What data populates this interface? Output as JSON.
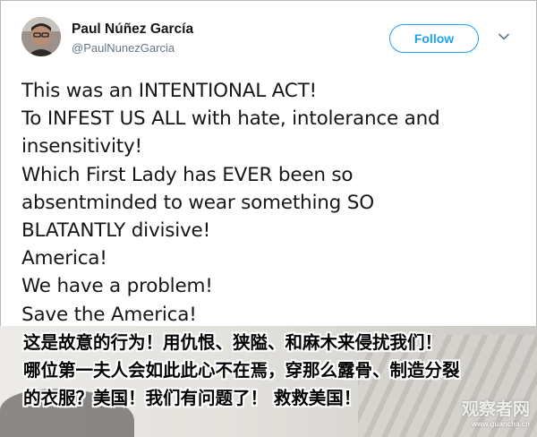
{
  "tweet": {
    "author": {
      "name": "Paul Núñez García",
      "handle": "@PaulNunezGarcia"
    },
    "follow_label": "Follow",
    "text_lines": [
      "This was an INTENTIONAL ACT!",
      "To INFEST US ALL with hate,  intolerance and",
      "insensitivity!",
      "Which First Lady has EVER been so",
      "absentminded to wear something SO",
      "BLATANTLY divisive!",
      "America!",
      "We have a problem!",
      "Save the America!"
    ]
  },
  "icons": {
    "more": "chevron-down-icon",
    "avatar": "avatar"
  },
  "colors": {
    "accent": "#1da1f2",
    "text": "#14171a",
    "secondary": "#657786"
  },
  "subtitles": [
    "这是故意的行为！用仇恨、狭隘、和麻木来侵扰我们！",
    "哪位第一夫人会如此此心不在焉，穿那么露骨、制造分裂",
    "的衣服？美国！我们有问题了！ 救救美国！"
  ],
  "watermark": {
    "main": "观察者网",
    "url": "www.guancha.cn"
  }
}
